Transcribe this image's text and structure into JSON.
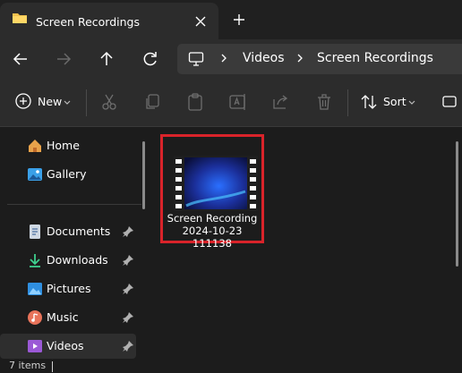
{
  "tab": {
    "title": "Screen Recordings"
  },
  "address": {
    "crumbs": [
      "Videos",
      "Screen Recordings"
    ]
  },
  "command_bar": {
    "new_label": "New",
    "sort_label": "Sort"
  },
  "sidebar": {
    "items": [
      {
        "label": "Home",
        "icon": "home-icon",
        "pinned": false
      },
      {
        "label": "Gallery",
        "icon": "gallery-icon",
        "pinned": false
      },
      {
        "label": "Documents",
        "icon": "documents-icon",
        "pinned": true
      },
      {
        "label": "Downloads",
        "icon": "downloads-icon",
        "pinned": true
      },
      {
        "label": "Pictures",
        "icon": "pictures-icon",
        "pinned": true
      },
      {
        "label": "Music",
        "icon": "music-icon",
        "pinned": true
      },
      {
        "label": "Videos",
        "icon": "videos-icon",
        "pinned": true,
        "selected": true
      }
    ]
  },
  "files": [
    {
      "name_lines": [
        "Screen Recording",
        "2024-10-23",
        "111138"
      ],
      "type": "video"
    }
  ],
  "status": {
    "item_count": "7 items"
  },
  "colors": {
    "highlight": "#d9232a",
    "folder": "#f2c14e",
    "background": "#1c1c1c"
  }
}
